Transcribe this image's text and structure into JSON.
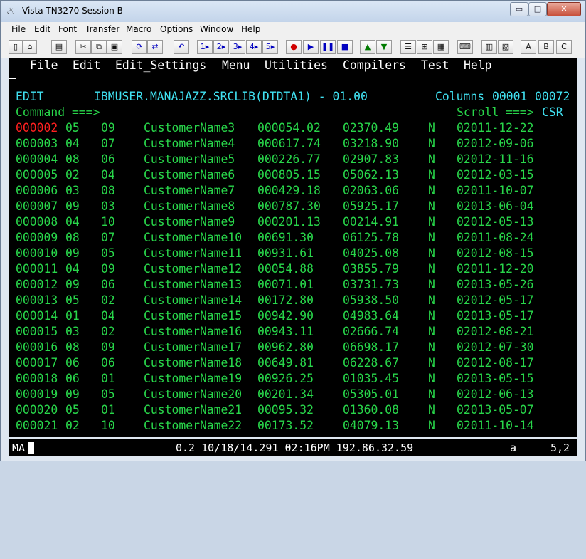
{
  "window": {
    "title": "Vista TN3270 Session B",
    "controls": {
      "minimize": "▭",
      "maximize": "□",
      "close": "✕"
    }
  },
  "menubar": [
    "File",
    "Edit",
    "Font",
    "Transfer",
    "Macro",
    "Options",
    "Window",
    "Help"
  ],
  "toolbar": {
    "groups": [
      {
        "icons": [
          "new-icon",
          "open-icon"
        ]
      },
      {
        "icons": [
          "print-icon"
        ]
      },
      {
        "icons": [
          "cut-icon",
          "copy-icon",
          "paste-icon"
        ]
      },
      {
        "icons": [
          "refresh-icon",
          "transfer-icon"
        ]
      },
      {
        "icons": [
          "undo-icon"
        ]
      },
      {
        "labels": [
          "1",
          "2",
          "3",
          "4",
          "5"
        ],
        "icon": "macro-play-icon"
      },
      {
        "icons": [
          "record-icon",
          "play-icon",
          "pause-icon",
          "stop-icon"
        ]
      },
      {
        "icons": [
          "upload-icon",
          "download-icon"
        ]
      },
      {
        "icons": [
          "settings-icon",
          "session-icon",
          "screen-icon"
        ]
      },
      {
        "icons": [
          "keyboard-icon"
        ]
      },
      {
        "icons": [
          "notepad-icon",
          "notes-icon"
        ]
      },
      {
        "labels": [
          "A",
          "B",
          "C"
        ]
      }
    ]
  },
  "ispf": {
    "action_bar": [
      "File",
      "Edit",
      "Edit_Settings",
      "Menu",
      "Utilities",
      "Compilers",
      "Test",
      "Help"
    ],
    "mode": "EDIT",
    "dataset": "IBMUSER.MANAJAZZ.SRCLIB(DTDTA1) - 01.00",
    "columns_label": "Columns",
    "columns_from": "00001",
    "columns_to": "00072",
    "command_label": "Command ===>",
    "command_value": "",
    "scroll_label": "Scroll ===>",
    "scroll_value": "CSR",
    "rows": [
      {
        "seq": "000002",
        "a": "05",
        "b": "09",
        "name": "CustomerName3",
        "amt1": "000054.02",
        "amt2": "02370.49",
        "flag": "N",
        "date": "02011-12-22"
      },
      {
        "seq": "000003",
        "a": "04",
        "b": "07",
        "name": "CustomerName4",
        "amt1": "000617.74",
        "amt2": "03218.90",
        "flag": "N",
        "date": "02012-09-06"
      },
      {
        "seq": "000004",
        "a": "08",
        "b": "06",
        "name": "CustomerName5",
        "amt1": "000226.77",
        "amt2": "02907.83",
        "flag": "N",
        "date": "02012-11-16"
      },
      {
        "seq": "000005",
        "a": "02",
        "b": "04",
        "name": "CustomerName6",
        "amt1": "000805.15",
        "amt2": "05062.13",
        "flag": "N",
        "date": "02012-03-15"
      },
      {
        "seq": "000006",
        "a": "03",
        "b": "08",
        "name": "CustomerName7",
        "amt1": "000429.18",
        "amt2": "02063.06",
        "flag": "N",
        "date": "02011-10-07"
      },
      {
        "seq": "000007",
        "a": "09",
        "b": "03",
        "name": "CustomerName8",
        "amt1": "000787.30",
        "amt2": "05925.17",
        "flag": "N",
        "date": "02013-06-04"
      },
      {
        "seq": "000008",
        "a": "04",
        "b": "10",
        "name": "CustomerName9",
        "amt1": "000201.13",
        "amt2": "00214.91",
        "flag": "N",
        "date": "02012-05-13"
      },
      {
        "seq": "000009",
        "a": "08",
        "b": "07",
        "name": "CustomerName10",
        "amt1": "00691.30",
        "amt2": "06125.78",
        "flag": "N",
        "date": "02011-08-24"
      },
      {
        "seq": "000010",
        "a": "09",
        "b": "05",
        "name": "CustomerName11",
        "amt1": "00931.61",
        "amt2": "04025.08",
        "flag": "N",
        "date": "02012-08-15"
      },
      {
        "seq": "000011",
        "a": "04",
        "b": "09",
        "name": "CustomerName12",
        "amt1": "00054.88",
        "amt2": "03855.79",
        "flag": "N",
        "date": "02011-12-20"
      },
      {
        "seq": "000012",
        "a": "09",
        "b": "06",
        "name": "CustomerName13",
        "amt1": "00071.01",
        "amt2": "03731.73",
        "flag": "N",
        "date": "02013-05-26"
      },
      {
        "seq": "000013",
        "a": "05",
        "b": "02",
        "name": "CustomerName14",
        "amt1": "00172.80",
        "amt2": "05938.50",
        "flag": "N",
        "date": "02012-05-17"
      },
      {
        "seq": "000014",
        "a": "01",
        "b": "04",
        "name": "CustomerName15",
        "amt1": "00942.90",
        "amt2": "04983.64",
        "flag": "N",
        "date": "02013-05-17"
      },
      {
        "seq": "000015",
        "a": "03",
        "b": "02",
        "name": "CustomerName16",
        "amt1": "00943.11",
        "amt2": "02666.74",
        "flag": "N",
        "date": "02012-08-21"
      },
      {
        "seq": "000016",
        "a": "08",
        "b": "09",
        "name": "CustomerName17",
        "amt1": "00962.80",
        "amt2": "06698.17",
        "flag": "N",
        "date": "02012-07-30"
      },
      {
        "seq": "000017",
        "a": "06",
        "b": "06",
        "name": "CustomerName18",
        "amt1": "00649.81",
        "amt2": "06228.67",
        "flag": "N",
        "date": "02012-08-17"
      },
      {
        "seq": "000018",
        "a": "06",
        "b": "01",
        "name": "CustomerName19",
        "amt1": "00926.25",
        "amt2": "01035.45",
        "flag": "N",
        "date": "02013-05-15"
      },
      {
        "seq": "000019",
        "a": "09",
        "b": "05",
        "name": "CustomerName20",
        "amt1": "00201.34",
        "amt2": "05305.01",
        "flag": "N",
        "date": "02012-06-13"
      },
      {
        "seq": "000020",
        "a": "05",
        "b": "01",
        "name": "CustomerName21",
        "amt1": "00095.32",
        "amt2": "01360.08",
        "flag": "N",
        "date": "02013-05-07"
      },
      {
        "seq": "000021",
        "a": "02",
        "b": "10",
        "name": "CustomerName22",
        "amt1": "00173.52",
        "amt2": "04079.13",
        "flag": "N",
        "date": "02011-10-14"
      }
    ]
  },
  "status": {
    "mode_indicator": "MA",
    "info": "0.2 10/18/14.291 02:16PM 192.86.32.59",
    "keyboard": "a",
    "cursor_pos": "5,2"
  },
  "colors": {
    "screen_bg": "#000000",
    "ispf_green": "#28d64a",
    "ispf_cyan": "#40e0f0",
    "ispf_white": "#ffffff",
    "ispf_red": "#ff2020"
  }
}
